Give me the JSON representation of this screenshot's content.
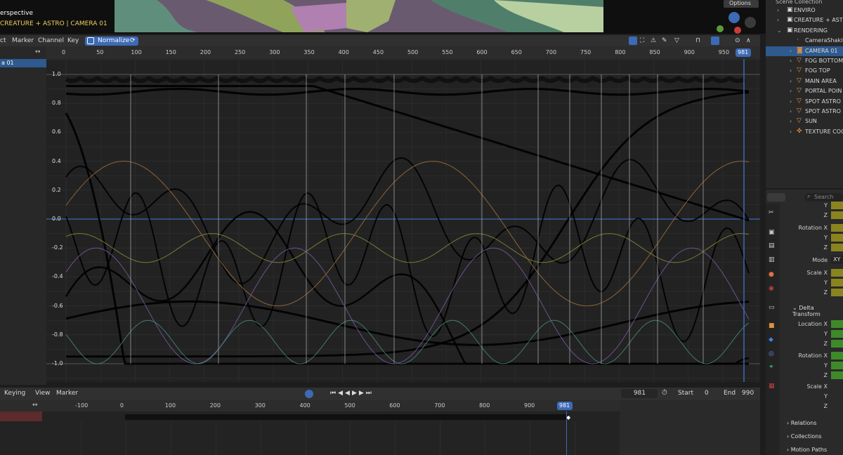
{
  "viewport": {
    "mode_label": "erspective",
    "collection_label": "CREATURE + ASTRO | CAMERA 01",
    "options_label": "Options"
  },
  "graph_editor": {
    "menus": [
      "ct",
      "Marker",
      "Channel",
      "Key"
    ],
    "normalize_label": "Normalize",
    "channel_selected": "a 01",
    "current_frame": "981",
    "ruler_ticks": [
      "0",
      "50",
      "100",
      "150",
      "200",
      "250",
      "300",
      "350",
      "400",
      "450",
      "500",
      "550",
      "600",
      "650",
      "700",
      "750",
      "800",
      "850",
      "900",
      "950"
    ],
    "y_ticks": [
      "1.0",
      "0.8",
      "0.6",
      "0.4",
      "0.2",
      "0.0",
      "-0.2",
      "-0.4",
      "-0.6",
      "-0.8",
      "-1.0"
    ]
  },
  "timeline": {
    "menus": [
      "Keying",
      "View",
      "Marker"
    ],
    "ruler_ticks": [
      "-100",
      "0",
      "100",
      "200",
      "300",
      "400",
      "500",
      "600",
      "700",
      "800",
      "900"
    ],
    "current_frame": "981",
    "frame_field": "981",
    "start_label": "Start",
    "start_value": "0",
    "end_label": "End",
    "end_value": "990"
  },
  "outliner": {
    "title": "Scene Collection",
    "items": [
      {
        "label": "ENVIRO",
        "icon": "collection-icon"
      },
      {
        "label": "CREATURE + ASTRO",
        "icon": "collection-icon"
      },
      {
        "label": "RENDERING",
        "icon": "collection-icon"
      },
      {
        "label": "CameraShakif",
        "icon": "object-icon"
      },
      {
        "label": "CAMERA 01",
        "icon": "camera-icon"
      },
      {
        "label": "FOG BOTTOM",
        "icon": "light-icon"
      },
      {
        "label": "FOG TOP",
        "icon": "light-icon"
      },
      {
        "label": "MAIN AREA",
        "icon": "light-icon"
      },
      {
        "label": "PORTAL POIN",
        "icon": "light-icon"
      },
      {
        "label": "SPOT ASTRO",
        "icon": "light-icon"
      },
      {
        "label": "SPOT ASTRO",
        "icon": "light-icon"
      },
      {
        "label": "SUN",
        "icon": "light-icon"
      },
      {
        "label": "TEXTURE COO",
        "icon": "empty-icon"
      }
    ]
  },
  "properties": {
    "search_placeholder": "Search",
    "labels": {
      "y0": "Y",
      "z0": "Z",
      "rotation_x": "Rotation X",
      "y1": "Y",
      "z1": "Z",
      "mode": "Mode",
      "mode_value": "XY",
      "scale_x": "Scale X",
      "y2": "Y",
      "z2": "Z",
      "delta_transform": "Delta Transform",
      "location_x": "Location X",
      "y3": "Y",
      "z3": "Z",
      "rotation_x2": "Rotation X",
      "y4": "Y",
      "z4": "Z",
      "scale_x2": "Scale X",
      "y5": "Y",
      "z5": "Z",
      "relations": "Relations",
      "collections": "Collections",
      "motion_paths": "Motion Paths"
    }
  }
}
